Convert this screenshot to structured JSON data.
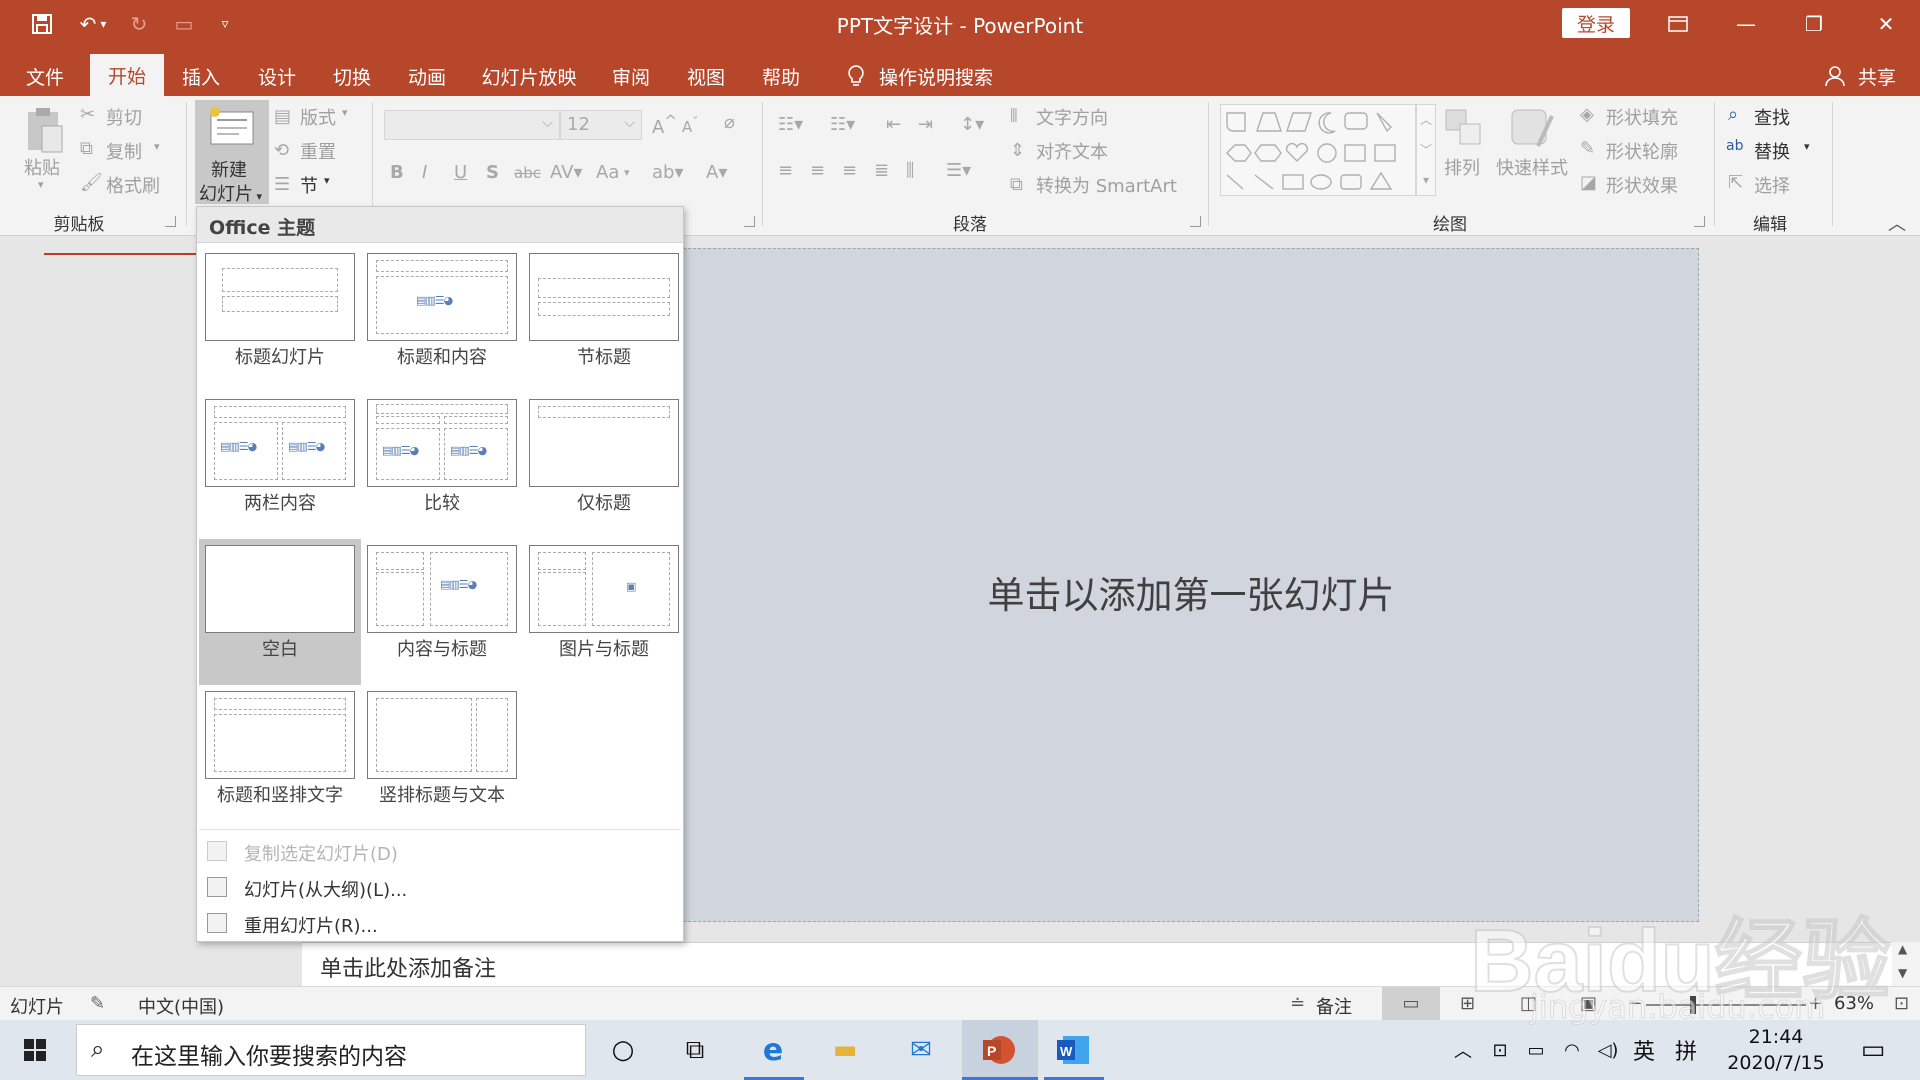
{
  "title_bar": {
    "document_title": "PPT文字设计 - PowerPoint",
    "login_label": "登录",
    "quick_access": [
      "save-icon",
      "undo-icon",
      "redo-icon",
      "present-icon",
      "customize-icon"
    ]
  },
  "ribbon": {
    "tabs": [
      "文件",
      "开始",
      "插入",
      "设计",
      "切换",
      "动画",
      "幻灯片放映",
      "审阅",
      "视图",
      "帮助"
    ],
    "active_tab": "开始",
    "tell_me": "操作说明搜索",
    "share": "共享",
    "clipboard": {
      "paste": "粘贴",
      "cut": "剪切",
      "copy": "复制",
      "format_painter": "格式刷",
      "label": "剪贴板"
    },
    "slides": {
      "new_slide_line1": "新建",
      "new_slide_line2": "幻灯片",
      "layout": "版式",
      "reset": "重置",
      "section": "节"
    },
    "font": {
      "size": "12",
      "aa": "Aa"
    },
    "paragraph": {
      "text_direction": "文字方向",
      "align_text": "对齐文本",
      "convert_smartart": "转换为 SmartArt",
      "label": "段落"
    },
    "drawing": {
      "arrange": "排列",
      "quick_styles": "快速样式",
      "shape_fill": "形状填充",
      "shape_outline": "形状轮廓",
      "shape_effects": "形状效果",
      "label": "绘图"
    },
    "editing": {
      "find": "查找",
      "replace": "替换",
      "select": "选择",
      "label": "编辑"
    }
  },
  "slide": {
    "placeholder": "单击以添加第一张幻灯片"
  },
  "notes": {
    "placeholder": "单击此处添加备注"
  },
  "layout_gallery": {
    "header": "Office 主题",
    "layouts": [
      {
        "name": "标题幻灯片"
      },
      {
        "name": "标题和内容"
      },
      {
        "name": "节标题"
      },
      {
        "name": "两栏内容"
      },
      {
        "name": "比较"
      },
      {
        "name": "仅标题"
      },
      {
        "name": "空白",
        "selected": true
      },
      {
        "name": "内容与标题"
      },
      {
        "name": "图片与标题"
      },
      {
        "name": "标题和竖排文字"
      },
      {
        "name": "竖排标题与文本"
      }
    ],
    "menu": [
      {
        "label": "复制选定幻灯片(D)",
        "disabled": true
      },
      {
        "label": "幻灯片(从大纲)(L)..."
      },
      {
        "label": "重用幻灯片(R)..."
      }
    ]
  },
  "status_bar": {
    "slide_label": "幻灯片",
    "language": "中文(中国)",
    "notes": "备注",
    "zoom": "63%"
  },
  "taskbar": {
    "search_placeholder": "在这里输入你要搜索的内容",
    "ime_lang": "英",
    "ime_mode": "拼",
    "time": "21:44",
    "date": "2020/7/15"
  },
  "watermark": {
    "logo": "Baidu经验",
    "url": "jingyan.baidu.com"
  },
  "colors": {
    "accent": "#b7472a",
    "slide_bg": "#d0d5de",
    "selected_layout": "#c8c8c8"
  }
}
